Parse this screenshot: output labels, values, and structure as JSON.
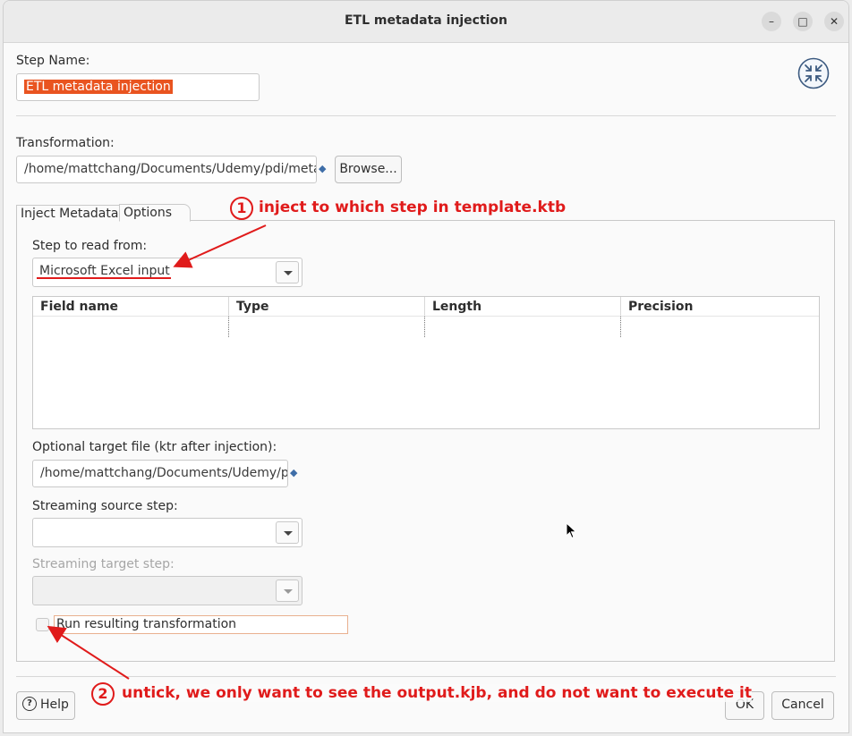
{
  "window": {
    "title": "ETL metadata injection"
  },
  "step_name": {
    "label": "Step Name:",
    "value": "ETL metadata injection"
  },
  "transformation": {
    "label": "Transformation:",
    "value": "/home/mattchang/Documents/Udemy/pdi/meta",
    "browse_label": "Browse..."
  },
  "tabs": [
    {
      "label": "Inject Metadata"
    },
    {
      "label": "Options"
    }
  ],
  "options": {
    "step_to_read_label": "Step to read from:",
    "step_to_read_value": "Microsoft Excel input",
    "grid_headers": [
      "Field name",
      "Type",
      "Length",
      "Precision"
    ],
    "target_file_label": "Optional target file (ktr after injection):",
    "target_file_value": "/home/mattchang/Documents/Udemy/p",
    "streaming_source_label": "Streaming source step:",
    "streaming_source_value": "",
    "streaming_target_label": "Streaming target step:",
    "streaming_target_value": "",
    "run_label": "Run resulting transformation",
    "run_checked": false
  },
  "annotations": [
    {
      "number": "1",
      "text": "inject to which step in template.ktb"
    },
    {
      "number": "2",
      "text": "untick, we only want to see the output.kjb, and do not want to execute it"
    }
  ],
  "footer": {
    "help_label": "Help",
    "ok_label": "OK",
    "cancel_label": "Cancel"
  },
  "colors": {
    "annotation": "#e01b1b",
    "selection": "#e95420"
  },
  "icons": [
    "minimize-icon",
    "maximize-icon",
    "close-icon",
    "etl-injection-icon",
    "variable-icon",
    "help-icon",
    "dropdown-arrow-icon"
  ]
}
